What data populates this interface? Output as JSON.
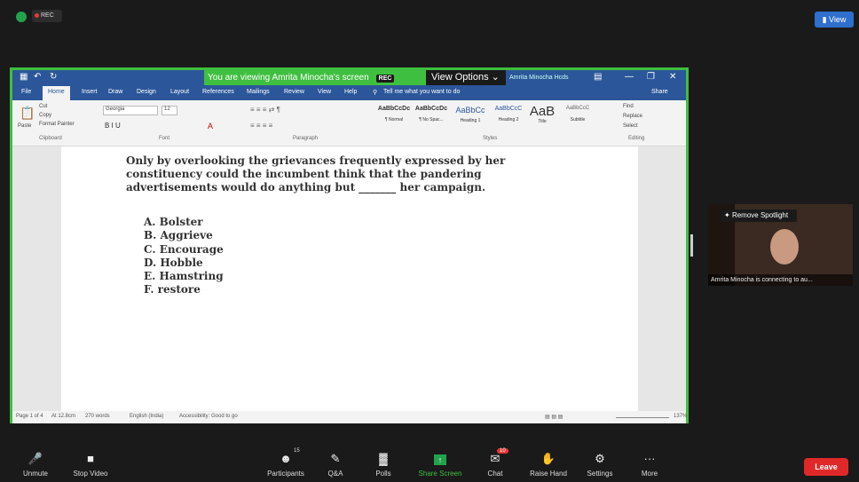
{
  "topbar": {
    "rec": "REC",
    "view_button": "View"
  },
  "shared": {
    "viewing_text": "You are viewing Amrita Minocha's screen",
    "rec_badge": "REC",
    "view_options": "View Options",
    "title_right": "Amrita Minocha Hcds",
    "ribbon_tabs": [
      "File",
      "Home",
      "Insert",
      "Draw",
      "Design",
      "Layout",
      "References",
      "Mailings",
      "Review",
      "View",
      "Help"
    ],
    "tell_me": "Tell me what you want to do",
    "share": "Share",
    "font_name": "Georgia",
    "font_size": "12",
    "styles": [
      {
        "sample": "AaBbCcDc",
        "name": "¶ Normal"
      },
      {
        "sample": "AaBbCcDc",
        "name": "¶ No Spac..."
      },
      {
        "sample": "AaBbCc",
        "name": "Heading 1"
      },
      {
        "sample": "AaBbCcC",
        "name": "Heading 2"
      },
      {
        "sample": "AaB",
        "name": "Title"
      },
      {
        "sample": "AaBbCcC",
        "name": "Subtitle"
      }
    ],
    "groups": {
      "clipboard": "Clipboard",
      "font": "Font",
      "paragraph": "Paragraph",
      "styles": "Styles",
      "editing": "Editing"
    },
    "clipboard": {
      "paste": "Paste",
      "cut": "Cut",
      "copy": "Copy",
      "format_painter": "Format Painter"
    },
    "editing": {
      "find": "Find",
      "replace": "Replace",
      "select": "Select"
    },
    "question": "Only by overlooking the grievances frequently expressed by her constituency could the incumbent think that the pandering advertisements would do anything but _______ her campaign.",
    "options": [
      "A. Bolster",
      "B. Aggrieve",
      "C. Encourage",
      "D. Hobble",
      "E. Hamstring",
      "F. restore"
    ],
    "status": {
      "page": "Page 1 of 4",
      "words_at": "At 12.8cm",
      "words": "270 words",
      "language": "English (India)",
      "accessibility": "Accessibility: Good to go",
      "zoom": "137%"
    }
  },
  "video": {
    "spotlight_button": "Remove Spotlight",
    "caption": "Amrita Minocha is connecting to au..."
  },
  "toolbar": {
    "items": [
      {
        "label": "Unmute"
      },
      {
        "label": "Stop Video"
      },
      {
        "label": "Participants",
        "badge": "15"
      },
      {
        "label": "Q&A"
      },
      {
        "label": "Polls"
      },
      {
        "label": "Share Screen"
      },
      {
        "label": "Chat",
        "badge": "10"
      },
      {
        "label": "Raise Hand"
      },
      {
        "label": "Settings"
      },
      {
        "label": "More"
      }
    ],
    "leave": "Leave"
  },
  "colors": {
    "share_border": "#3fbf3f",
    "word_blue": "#2b579a",
    "leave_red": "#e02828"
  }
}
